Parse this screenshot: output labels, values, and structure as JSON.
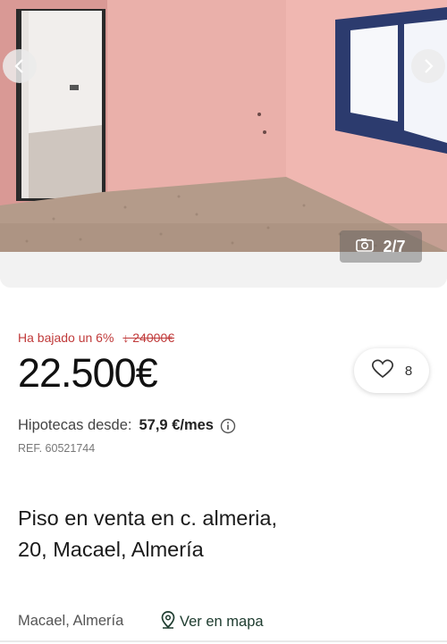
{
  "gallery": {
    "counter": "2/7",
    "prev_icon": "chevron-left-icon",
    "next_icon": "chevron-right-icon",
    "camera_icon": "camera-icon"
  },
  "listing": {
    "price_drop_label": "Ha bajado un 6%",
    "old_price": "↓ 24000€",
    "price": "22.500€",
    "favorites_count": "8",
    "mortgage_label": "Hipotecas desde:",
    "mortgage_value": "57,9 €/mes",
    "ref": "REF. 60521744",
    "title": "Piso en venta en c. almeria, 20, Macael, Almería",
    "location": "Macael, Almería",
    "map_link": "Ver en mapa"
  },
  "colors": {
    "price_drop": "#c03a3a",
    "map_link": "#1d3b2e",
    "wall": "#e8a9a4"
  }
}
